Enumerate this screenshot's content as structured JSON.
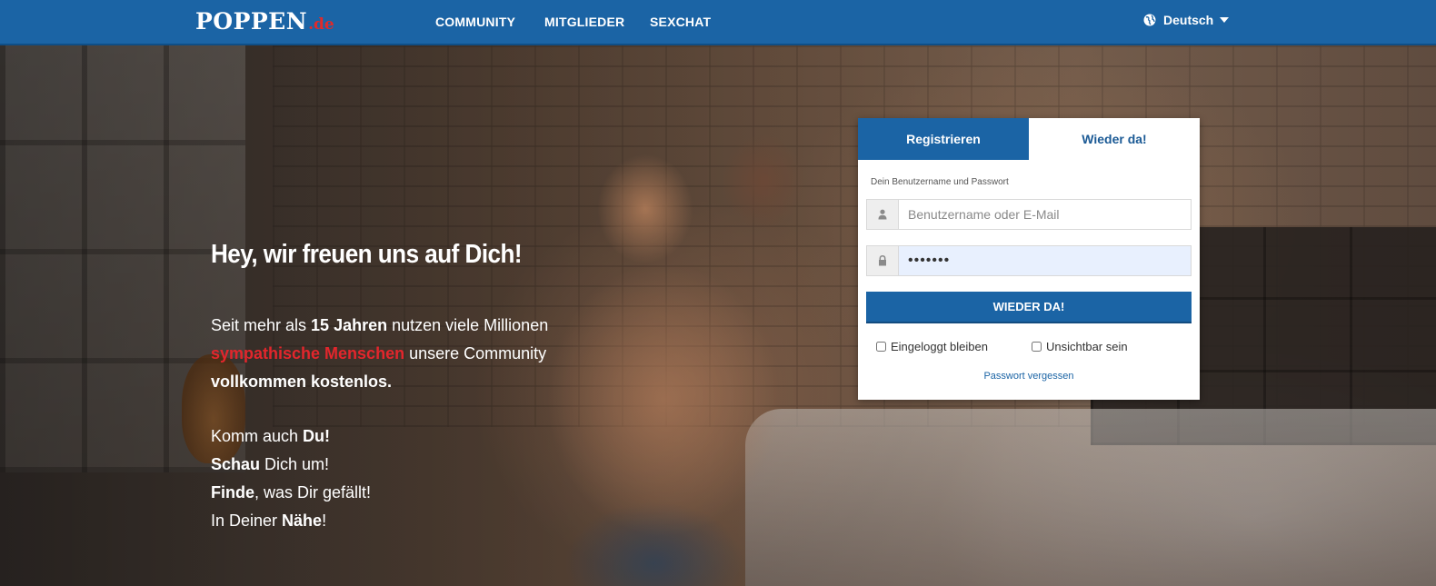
{
  "header": {
    "logo_main": "POPPEN",
    "logo_tld": ".de",
    "nav": [
      {
        "label": "COMMUNITY"
      },
      {
        "label": "MITGLIEDER"
      },
      {
        "label": "SEXCHAT"
      }
    ],
    "language": {
      "label": "Deutsch",
      "icon": "globe-icon"
    }
  },
  "hero": {
    "headline": "Hey, wir freuen uns auf Dich!",
    "intro": {
      "t1": "Seit mehr als ",
      "b1": "15 Jahren",
      "t2": " nutzen viele Millionen ",
      "red": "sympathische Menschen",
      "t3": " unsere Community ",
      "b2": "vollkommen kostenlos."
    },
    "lines": [
      {
        "pre": "Komm auch ",
        "bold": "Du!",
        "post": ""
      },
      {
        "pre": "",
        "bold": "Schau",
        "post": " Dich um!"
      },
      {
        "pre": "",
        "bold": "Finde",
        "post": ", was Dir gefällt!"
      },
      {
        "pre": "In Deiner ",
        "bold": "Nähe",
        "post": "!"
      }
    ]
  },
  "login": {
    "tabs": [
      {
        "label": "Registrieren",
        "active": false
      },
      {
        "label": "Wieder da!",
        "active": true
      }
    ],
    "hint": "Dein Benutzername und Passwort",
    "username": {
      "value": "",
      "placeholder": "Benutzername oder E-Mail",
      "icon": "user-icon"
    },
    "password": {
      "value": "•••••••",
      "icon": "lock-icon"
    },
    "submit_label": "WIEDER DA!",
    "checkbox_stay": {
      "label": "Eingeloggt bleiben",
      "checked": false
    },
    "checkbox_invisible": {
      "label": "Unsichtbar sein",
      "checked": false
    },
    "forgot_label": "Passwort vergessen"
  },
  "colors": {
    "brand_blue": "#1b64a5",
    "accent_red": "#e3262c"
  }
}
